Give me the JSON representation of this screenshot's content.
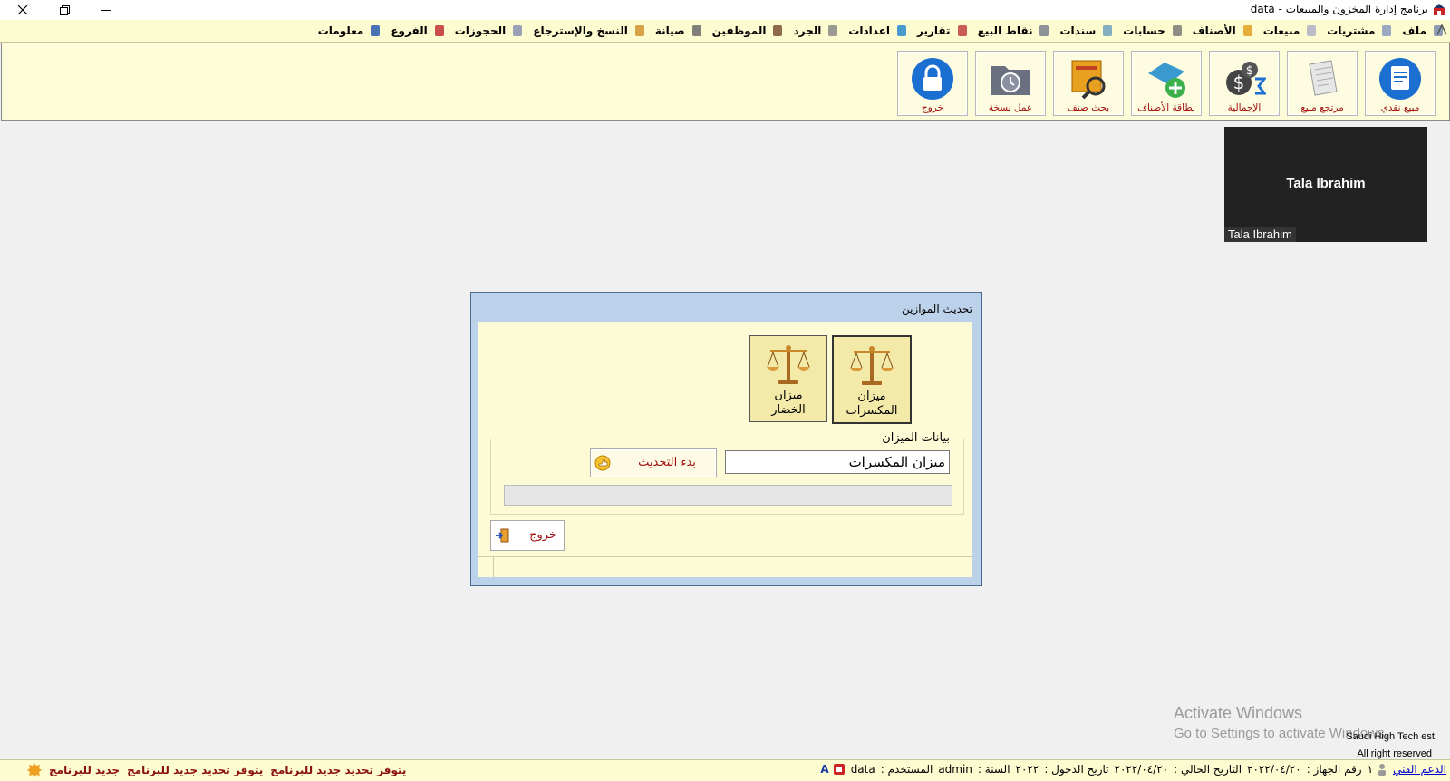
{
  "window": {
    "title": "برنامج إدارة المخزون والمبيعات  - data",
    "controls": {
      "close": "close-icon",
      "restore": "restore-icon",
      "minimize": "minimize-icon"
    }
  },
  "menu": {
    "items": [
      {
        "label": "ملف",
        "icon": "file-icon"
      },
      {
        "label": "مشتريات",
        "icon": "purchases-icon"
      },
      {
        "label": "مبيعات",
        "icon": "sales-icon"
      },
      {
        "label": "الأصناف",
        "icon": "items-icon"
      },
      {
        "label": "حسابات",
        "icon": "accounts-icon"
      },
      {
        "label": "سندات",
        "icon": "vouchers-icon"
      },
      {
        "label": "نقاط البيع",
        "icon": "pos-icon"
      },
      {
        "label": "تقارير",
        "icon": "reports-icon"
      },
      {
        "label": "اعدادات",
        "icon": "settings-icon"
      },
      {
        "label": "الجرد",
        "icon": "inventory-icon"
      },
      {
        "label": "الموظفين",
        "icon": "employees-icon"
      },
      {
        "label": "صيانة",
        "icon": "maintenance-icon"
      },
      {
        "label": "النسخ والإسترجاع",
        "icon": "backup-restore-icon"
      },
      {
        "label": "الحجوزات",
        "icon": "reservations-icon"
      },
      {
        "label": "الفروع",
        "icon": "branches-icon"
      },
      {
        "label": "معلومات",
        "icon": "info-icon"
      }
    ]
  },
  "toolbar": {
    "buttons": [
      {
        "label": "مبيع نقدي",
        "icon": "cash-sale-icon"
      },
      {
        "label": "مرتجع مبيع",
        "icon": "sales-return-icon"
      },
      {
        "label": "الإجمالية",
        "icon": "totals-icon"
      },
      {
        "label": "بطاقة الأصناف",
        "icon": "item-card-icon"
      },
      {
        "label": "بحث صنف",
        "icon": "item-search-icon"
      },
      {
        "label": "عمل نسخة",
        "icon": "backup-icon"
      },
      {
        "label": "خروج",
        "icon": "lock-icon"
      }
    ]
  },
  "video": {
    "name": "Tala Ibrahim",
    "caption": "Tala Ibrahim"
  },
  "dialog": {
    "title": "تحديث الموازين",
    "scales": [
      {
        "line1": "ميزان",
        "line2": "المكسرات",
        "icon": "balance-scale-icon",
        "selected": true
      },
      {
        "line1": "ميزان",
        "line2": "الخضار",
        "icon": "balance-scale-icon",
        "selected": false
      }
    ],
    "group_title": "بيانات الميزان",
    "scale_name_value": "ميزان المكسرات",
    "start_button": "بدء التحديث",
    "exit_button": "خروج",
    "progress": 0
  },
  "watermark": {
    "line1": "Activate Windows",
    "line2": "Go to Settings to activate Windows."
  },
  "copyright": {
    "line1": "Saudi High Tech est.",
    "line2": "All right reserved"
  },
  "status": {
    "db_name": "data",
    "user_label": "المستخدم :",
    "user_value": "admin",
    "year_label": "السنة :",
    "year_value": "٢٠٢٢",
    "login_label": "تاريخ الدخول :",
    "login_value": "٢٠٢٢/٠٤/٢٠",
    "current_label": "التاريخ الحالي :",
    "current_value": "٢٠٢٢/٠٤/٢٠",
    "device_label": "رقم الجهاز :",
    "device_value": "١",
    "support_link": "الدعم الفني",
    "news": [
      "جديد للبرنامج",
      "يتوفر تحديد جديد للبرنامج",
      "يتوفر تحديد جديد للبرنامج"
    ]
  }
}
